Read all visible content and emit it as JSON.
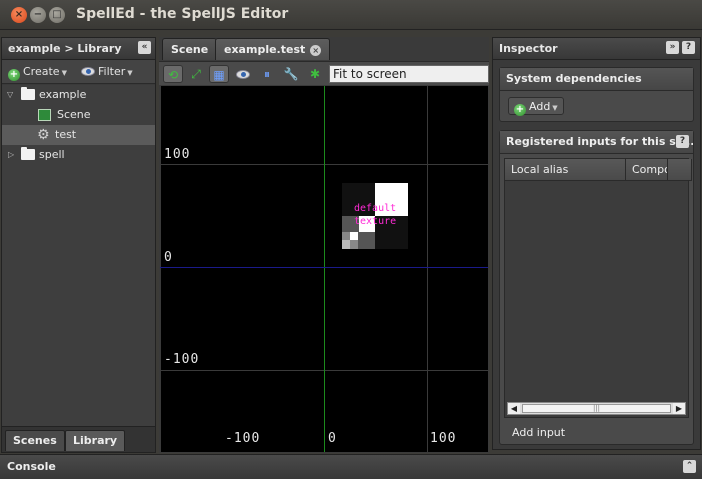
{
  "window": {
    "title": "SpellEd - the SpellJS Editor"
  },
  "left_panel": {
    "title": "example > Library",
    "collapse_icon": "double-chevron-left-icon",
    "toolbar": {
      "create_label": "Create",
      "filter_label": "Filter"
    },
    "tree": [
      {
        "label": "example",
        "icon": "folder-icon",
        "expanded": true
      },
      {
        "label": "Scene",
        "icon": "scene-icon"
      },
      {
        "label": "test",
        "icon": "gear-icon",
        "selected": true
      },
      {
        "label": "spell",
        "icon": "folder-icon",
        "expanded": false
      }
    ],
    "tabs": {
      "scenes": "Scenes",
      "library": "Library"
    }
  },
  "center": {
    "tabs": {
      "scene": "Scene",
      "file": "example.test"
    },
    "zoom": "Fit to screen",
    "canvas": {
      "y_labels": {
        "top": "100",
        "mid": "0",
        "bottom": "-100"
      },
      "x_labels": {
        "left": "-100",
        "mid": "0",
        "right": "100"
      },
      "texture_line1": "default",
      "texture_line2": "texture",
      "axis_color_y": "#1c8a1c",
      "axis_color_x": "#1a1a8a",
      "texture_text_color": "#ff2bd6"
    }
  },
  "inspector": {
    "title": "Inspector",
    "system_dependencies": {
      "title": "System dependencies",
      "add_label": "Add"
    },
    "registered_inputs": {
      "title": "Registered inputs for this sy...",
      "columns": [
        "Local alias",
        "Compo"
      ],
      "add_input_label": "Add input"
    }
  },
  "console": {
    "title": "Console"
  }
}
